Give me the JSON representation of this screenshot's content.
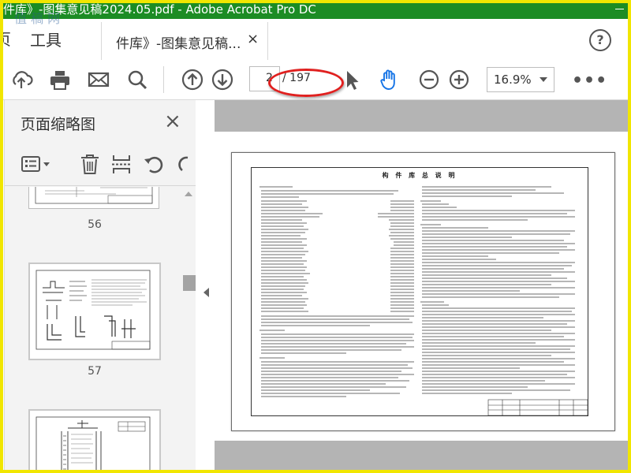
{
  "window": {
    "title": "件库》-图集意见稿2024.05.pdf - Adobe Acrobat Pro DC",
    "watermark": "值 稿 网"
  },
  "tabs": {
    "left_partial": "页",
    "tools": "工具",
    "document": "件库》-图集意见稿...",
    "close_symbol": "×",
    "help_symbol": "?"
  },
  "toolbar": {
    "icons": [
      "upload-icon",
      "print-icon",
      "mail-icon",
      "search-icon",
      "page-up-icon",
      "page-down-icon",
      "select-cursor-icon",
      "hand-tool-icon",
      "zoom-out-icon",
      "zoom-in-icon"
    ],
    "current_page": "2",
    "page_total": "/ 197",
    "zoom": "16.9%",
    "more_symbol": "•••"
  },
  "thumbnail_panel": {
    "title": "页面缩略图",
    "close_symbol": "×",
    "tools": [
      "options-menu-icon",
      "delete-icon",
      "insert-pages-icon",
      "undo-icon",
      "redo-icon"
    ],
    "thumbnails": [
      {
        "number": "56"
      },
      {
        "number": "57"
      }
    ]
  },
  "document": {
    "heading": "构 件 库 总 说 明",
    "sections": [
      "1 编制依据",
      "2 适用范围",
      "3 编制内容",
      "4 规格",
      "5 编制原则"
    ],
    "title_block": "图集总说明（一）"
  },
  "colors": {
    "titlebar": "#1c8c24",
    "frame": "#f1e600",
    "annotation": "#e0201f",
    "accent_blue": "#1473e6"
  }
}
